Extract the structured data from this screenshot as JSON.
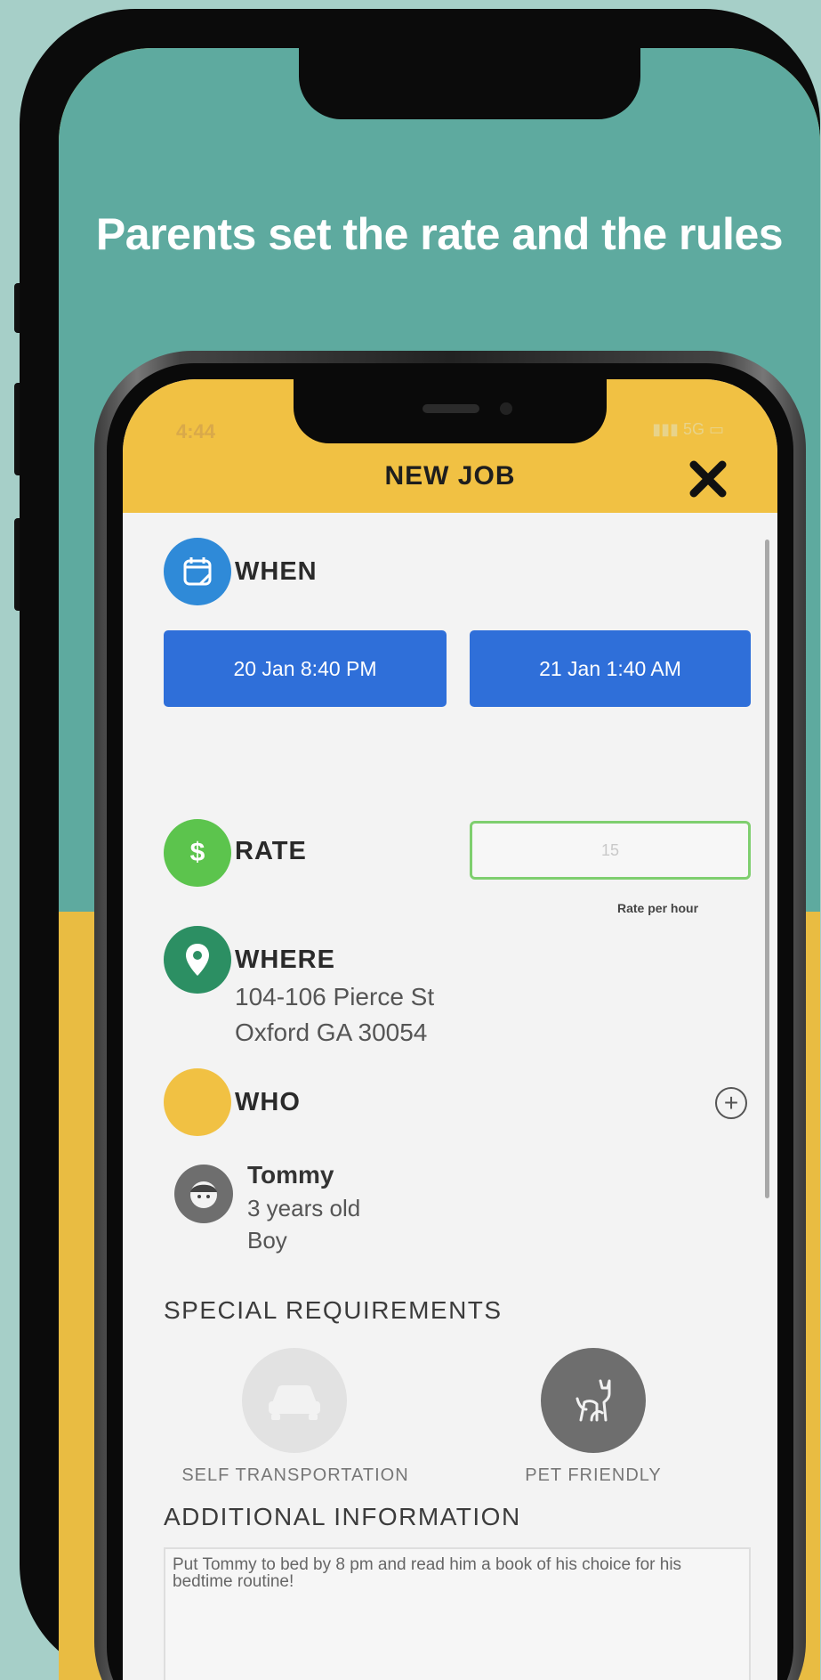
{
  "promo": {
    "headline": "Parents set the rate and the rules"
  },
  "status_bar": {
    "time": "4:44",
    "indicators": "5G"
  },
  "app": {
    "title": "NEW JOB",
    "close_icon": "close-icon"
  },
  "when": {
    "label": "WHEN",
    "icon": "calendar-icon",
    "start": "20 Jan 8:40 PM",
    "end": "21 Jan 1:40 AM",
    "icon_color": "#2f8ad8"
  },
  "rate": {
    "label": "RATE",
    "icon": "dollar-icon",
    "value": "15",
    "hint": "Rate per hour",
    "icon_color": "#5cc44d"
  },
  "where": {
    "label": "WHERE",
    "icon": "location-pin-icon",
    "address_line1": "104-106 Pierce St",
    "address_line2": "Oxford GA 30054",
    "icon_color": "#2c8f63"
  },
  "who": {
    "label": "WHO",
    "icon_color": "#f1c143",
    "add_icon": "plus-circle-icon",
    "child": {
      "name": "Tommy",
      "age": "3 years old",
      "gender": "Boy",
      "avatar_icon": "child-avatar-icon"
    }
  },
  "special_requirements": {
    "heading": "SPECIAL REQUIREMENTS",
    "items": [
      {
        "label": "SELF TRANSPORTATION",
        "icon": "car-icon",
        "selected": false
      },
      {
        "label": "PET FRIENDLY",
        "icon": "cat-icon",
        "selected": true
      }
    ]
  },
  "additional_information": {
    "heading": "ADDITIONAL INFORMATION",
    "text": "Put Tommy to bed by 8 pm and read him a book of his choice for his bedtime routine!"
  },
  "colors": {
    "teal_background": "#5eaa9f",
    "header_yellow": "#f1c143",
    "button_blue": "#2f6fd9"
  }
}
